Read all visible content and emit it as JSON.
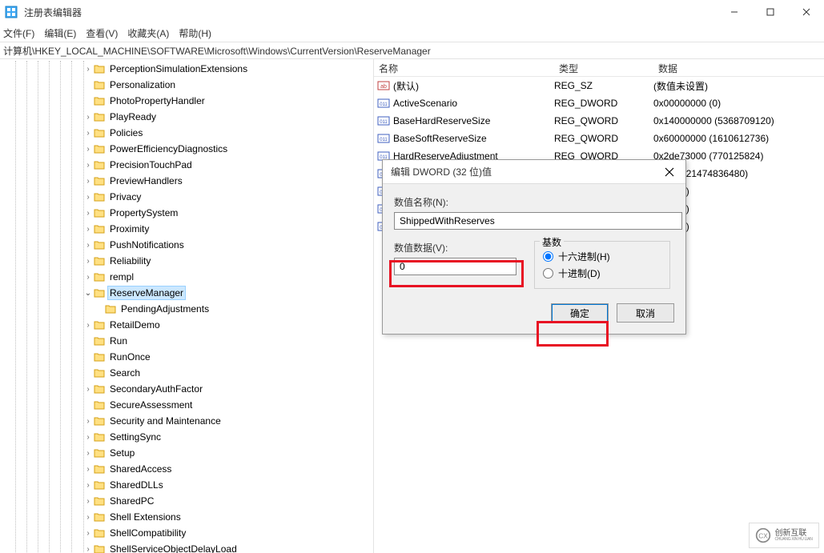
{
  "window": {
    "title": "注册表编辑器"
  },
  "menu": {
    "file": "文件(F)",
    "edit": "编辑(E)",
    "view": "查看(V)",
    "fav": "收藏夹(A)",
    "help": "帮助(H)"
  },
  "address": "计算机\\HKEY_LOCAL_MACHINE\\SOFTWARE\\Microsoft\\Windows\\CurrentVersion\\ReserveManager",
  "tree": {
    "tracks": [
      19,
      33,
      47,
      61,
      75,
      89,
      104
    ],
    "items": [
      {
        "indent": 104,
        "chev": ">",
        "label": "PerceptionSimulationExtensions"
      },
      {
        "indent": 104,
        "chev": "",
        "label": "Personalization"
      },
      {
        "indent": 104,
        "chev": "",
        "label": "PhotoPropertyHandler"
      },
      {
        "indent": 104,
        "chev": ">",
        "label": "PlayReady"
      },
      {
        "indent": 104,
        "chev": ">",
        "label": "Policies"
      },
      {
        "indent": 104,
        "chev": ">",
        "label": "PowerEfficiencyDiagnostics"
      },
      {
        "indent": 104,
        "chev": ">",
        "label": "PrecisionTouchPad"
      },
      {
        "indent": 104,
        "chev": ">",
        "label": "PreviewHandlers"
      },
      {
        "indent": 104,
        "chev": ">",
        "label": "Privacy"
      },
      {
        "indent": 104,
        "chev": ">",
        "label": "PropertySystem"
      },
      {
        "indent": 104,
        "chev": ">",
        "label": "Proximity"
      },
      {
        "indent": 104,
        "chev": ">",
        "label": "PushNotifications"
      },
      {
        "indent": 104,
        "chev": ">",
        "label": "Reliability"
      },
      {
        "indent": 104,
        "chev": ">",
        "label": "rempl"
      },
      {
        "indent": 104,
        "chev": "v",
        "label": "ReserveManager",
        "selected": true
      },
      {
        "indent": 118,
        "chev": "",
        "label": "PendingAdjustments"
      },
      {
        "indent": 104,
        "chev": ">",
        "label": "RetailDemo"
      },
      {
        "indent": 104,
        "chev": "",
        "label": "Run"
      },
      {
        "indent": 104,
        "chev": "",
        "label": "RunOnce"
      },
      {
        "indent": 104,
        "chev": "",
        "label": "Search"
      },
      {
        "indent": 104,
        "chev": ">",
        "label": "SecondaryAuthFactor"
      },
      {
        "indent": 104,
        "chev": "",
        "label": "SecureAssessment"
      },
      {
        "indent": 104,
        "chev": ">",
        "label": "Security and Maintenance"
      },
      {
        "indent": 104,
        "chev": ">",
        "label": "SettingSync"
      },
      {
        "indent": 104,
        "chev": ">",
        "label": "Setup"
      },
      {
        "indent": 104,
        "chev": ">",
        "label": "SharedAccess"
      },
      {
        "indent": 104,
        "chev": ">",
        "label": "SharedDLLs"
      },
      {
        "indent": 104,
        "chev": ">",
        "label": "SharedPC"
      },
      {
        "indent": 104,
        "chev": ">",
        "label": "Shell Extensions"
      },
      {
        "indent": 104,
        "chev": ">",
        "label": "ShellCompatibility"
      },
      {
        "indent": 104,
        "chev": ">",
        "label": "ShellServiceObjectDelayLoad"
      }
    ]
  },
  "list": {
    "headers": {
      "name": "名称",
      "type": "类型",
      "data": "数据"
    },
    "rows": [
      {
        "icon": "str",
        "name": "(默认)",
        "type": "REG_SZ",
        "data": "(数值未设置)"
      },
      {
        "icon": "bin",
        "name": "ActiveScenario",
        "type": "REG_DWORD",
        "data": "0x00000000 (0)"
      },
      {
        "icon": "bin",
        "name": "BaseHardReserveSize",
        "type": "REG_QWORD",
        "data": "0x140000000 (5368709120)"
      },
      {
        "icon": "bin",
        "name": "BaseSoftReserveSize",
        "type": "REG_QWORD",
        "data": "0x60000000 (1610612736)"
      },
      {
        "icon": "bin",
        "name": "HardReserveAdjustment",
        "type": "REG_QWORD",
        "data": "0x2de73000 (770125824)"
      },
      {
        "icon": "bin",
        "name": "",
        "type": "",
        "data": "00000 (21474836480)"
      },
      {
        "icon": "bin",
        "name": "",
        "type": "",
        "data": "0001 (1)"
      },
      {
        "icon": "bin",
        "name": "",
        "type": "",
        "data": "0001 (1)"
      },
      {
        "icon": "bin",
        "name": "",
        "type": "",
        "data": "0001 (1)"
      }
    ]
  },
  "dialog": {
    "title": "编辑 DWORD (32 位)值",
    "name_label": "数值名称(N):",
    "name_value": "ShippedWithReserves",
    "value_label": "数值数据(V):",
    "value_value": "0",
    "base_label": "基数",
    "radio_hex": "十六进制(H)",
    "radio_dec": "十进制(D)",
    "ok": "确定",
    "cancel": "取消"
  },
  "watermark": {
    "brand": "创新互联",
    "sub": "CHUANG XIN HU LIAN"
  }
}
